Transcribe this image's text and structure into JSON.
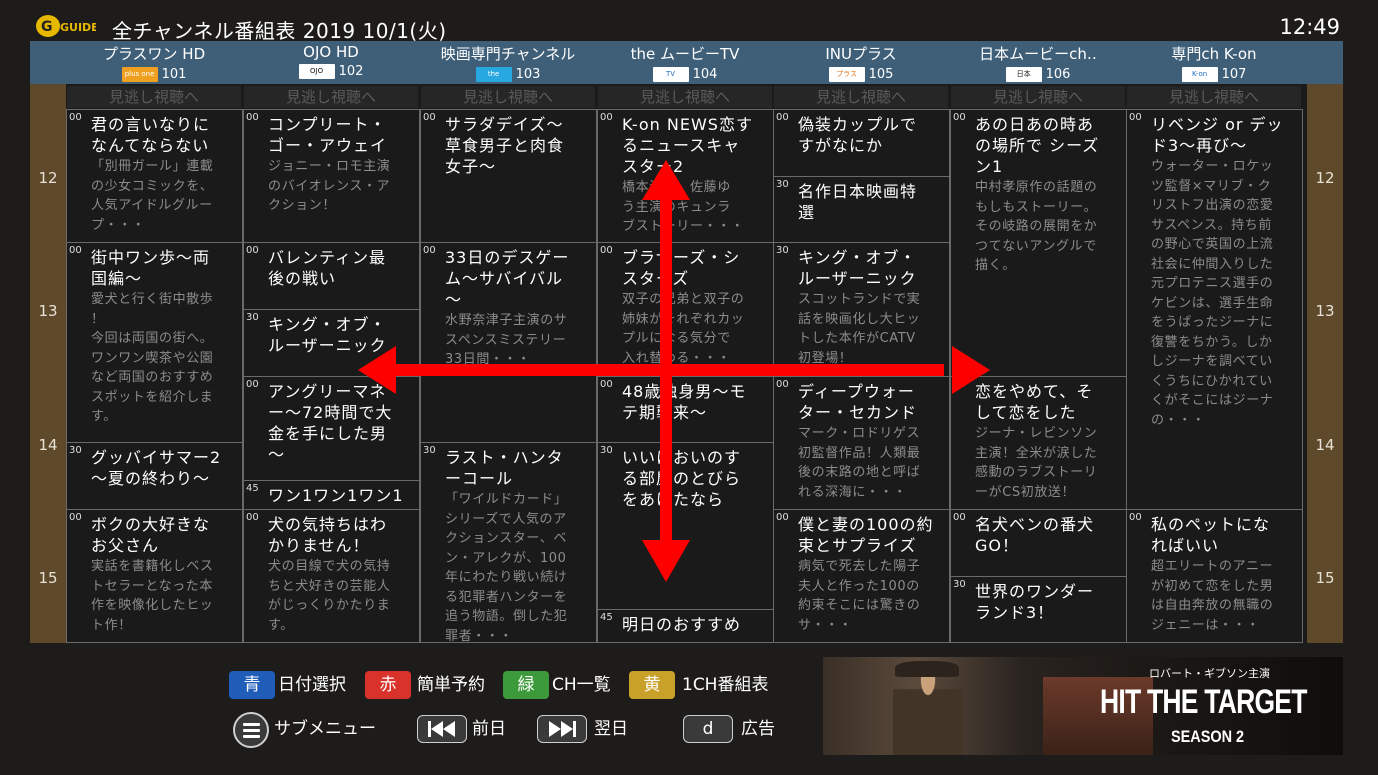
{
  "header": {
    "logo": "GUIDE",
    "title": "全チャンネル番組表 2019 10/1(火)",
    "clock": "12:49"
  },
  "channels": [
    {
      "name": "プラスワン HD",
      "logo": "plus one",
      "number": "101",
      "logo_bg": "#f0a020",
      "logo_fg": "#ffffff"
    },
    {
      "name": "OJO HD",
      "logo": "OJO",
      "number": "102",
      "logo_bg": "#ffffff",
      "logo_fg": "#111111"
    },
    {
      "name": "映画専門チャンネル",
      "logo": "the MOVIE",
      "number": "103",
      "logo_bg": "#27a8e0",
      "logo_fg": "#ffffff"
    },
    {
      "name": "the ムービーTV",
      "logo": "TV",
      "number": "104",
      "logo_bg": "#ffffff",
      "logo_fg": "#1b6fc4"
    },
    {
      "name": "INUプラス",
      "logo": "プラス",
      "number": "105",
      "logo_bg": "#ffffff",
      "logo_fg": "#e07010"
    },
    {
      "name": "日本ムービーch‥",
      "logo": "日本",
      "number": "106",
      "logo_bg": "#ffffff",
      "logo_fg": "#111111"
    },
    {
      "name": "専門ch K-on",
      "logo": "K-on",
      "number": "107",
      "logo_bg": "#ffffff",
      "logo_fg": "#1b6fc4"
    }
  ],
  "missed_label": "見逃し視聴へ",
  "hours": [
    "12",
    "13",
    "14",
    "15"
  ],
  "programs": [
    [
      {
        "min": "00",
        "title": "君の言いなりに\nなんてならない",
        "desc": "「別冊ガール」連載\nの少女コミックを、\n人気アイドルグルー\nプ・・・"
      },
      {
        "min": "00",
        "title": "街中ワン歩～両\n国編～",
        "desc": "愛犬と行く街中散歩\n！\n今回は両国の街へ。\nワンワン喫茶や公園\nなど両国のおすすめ\nスポットを紹介しま\nす。"
      },
      {
        "min": "30",
        "title": "グッバイサマー2\n～夏の終わり～",
        "desc": ""
      },
      {
        "min": "00",
        "title": "ボクの大好きな\nお父さん",
        "desc": "実話を書籍化しベス\nトセラーとなった本\n作を映像化したヒッ\nト作！"
      }
    ],
    [
      {
        "min": "00",
        "title": "コンプリート・\nゴー・アウェイ",
        "desc": "ジョニー・ロモ主演\nのバイオレンス・ア\nクション！"
      },
      {
        "min": "00",
        "title": "バレンティン最\n後の戦い",
        "desc": ""
      },
      {
        "min": "30",
        "title": "キング・オブ・\nルーザーニック",
        "desc": ""
      },
      {
        "min": "00",
        "title": "アングリーマネ\nー～72時間で大\n金を手にした男\n～",
        "desc": ""
      },
      {
        "min": "45",
        "title": "ワン1ワン1ワン1",
        "desc": ""
      },
      {
        "min": "00",
        "title": "犬の気持ちはわ\nかりません！",
        "desc": "犬の目線で犬の気持\nちと犬好きの芸能人\nがじっくりかたりま\nす。"
      }
    ],
    [
      {
        "min": "00",
        "title": "サラダデイズ～\n草食男子と肉食\n女子～",
        "desc": ""
      },
      {
        "min": "00",
        "title": "33日のデスゲー\nム～サバイバル\n～",
        "desc": "水野奈津子主演のサ\nスペンスミステリー\n33日間・・・"
      },
      {
        "min": "30",
        "title": "ラスト・ハンタ\nーコール",
        "desc": "「ワイルドカード」\nシリーズで人気のア\nクションスター、ベ\nン・アレクが、100\n年にわたり戦い続け\nる犯罪者ハンターを\n追う物語。倒した犯\n罪者・・・"
      }
    ],
    [
      {
        "min": "00",
        "title": "K-on NEWS恋す\nるニュースキャ\nスター2",
        "desc": "橋本海斗、佐藤ゆ\nう主演のキュンラ\nブストーリー・・・"
      },
      {
        "min": "00",
        "title": "ブラザーズ・シ\nスターズ",
        "desc": "双子の兄弟と双子の\n姉妹がそれぞれカッ\nプルになる気分で\n入れ替わる・・・"
      },
      {
        "min": "00",
        "title": "48歳独身男～モ\nテ期襲来～",
        "desc": ""
      },
      {
        "min": "30",
        "title": "いいにおいのす\nる部屋のとびら\nをあけたなら",
        "desc": ""
      },
      {
        "min": "45",
        "title": "明日のおすすめ",
        "desc": ""
      }
    ],
    [
      {
        "min": "00",
        "title": "偽装カップルで\nすがなにか",
        "desc": ""
      },
      {
        "min": "30",
        "title": "名作日本映画特\n選",
        "desc": ""
      },
      {
        "min": "30",
        "title": "キング・オブ・\nルーザーニック",
        "desc": "スコットランドで実\n話を映画化し大ヒッ\nトした本作がCATV\n初登場！"
      },
      {
        "min": "00",
        "title": "ディープウォー\nター・セカンド",
        "desc": "マーク・ロドリゲス\n初監督作品！人類最\n後の末路の地と呼ば\nれる深海に・・・"
      },
      {
        "min": "00",
        "title": "僕と妻の100の約\n束とサプライズ",
        "desc": "病気で死去した陽子\n夫人と作った100の\n約束そこには驚きの\nサ・・・"
      }
    ],
    [
      {
        "min": "00",
        "title": "あの日あの時あ\nの場所で シーズ\nン1",
        "desc": "中村孝原作の話題の\nもしもストーリー。\nその岐路の展開をか\nつてないアングルで\n描く。"
      },
      {
        "min": "00",
        "title": "恋をやめて、そ\nして恋をした",
        "desc": "ジーナ・レビンソン\n主演！全米が涙した\n感動のラブストーリ\nーがCS初放送！"
      },
      {
        "min": "00",
        "title": "名犬ベンの番犬\nGO！",
        "desc": ""
      },
      {
        "min": "30",
        "title": "世界のワンダー\nランド3！",
        "desc": ""
      }
    ],
    [
      {
        "min": "00",
        "title": "リベンジ or デッ\nド3～再び～",
        "desc": "ウォーター・ロケッ\nツ監督×マリブ・ク\nリストフ出演の恋愛\nサスペンス。持ち前\nの野心で英国の上流\n社会に仲間入りした\n元プロテニス選手の\nケビンは、選手生命\nをうばったジーナに\n復讐をちかう。しか\nしジーナを調べてい\nくうちにひかれてい\nくがそこにはジーナ\nの・・・"
      },
      {
        "min": "00",
        "title": "私のペットにな\nればいい",
        "desc": "超エリートのアニー\nが初めて恋をした男\nは自由奔放の無職の\nジェニーは・・・"
      }
    ]
  ],
  "footer": {
    "blue_key": "青",
    "blue_label": "日付選択",
    "red_key": "赤",
    "red_label": "簡単予約",
    "green_key": "緑",
    "green_label": "CH一覧",
    "yellow_key": "黄",
    "yellow_label": "1CH番組表",
    "submenu_label": "サブメニュー",
    "prev_label": "前日",
    "next_label": "翌日",
    "d_key": "d",
    "ad_label": "広告"
  },
  "ad": {
    "subtitle": "ロバート・ギブソン主演",
    "title": "HIT THE TARGET",
    "season": "SEASON 2"
  },
  "colors": {
    "blue": "#1f5db8",
    "red": "#d8322a",
    "green": "#3d9a3a",
    "yellow": "#c9a028",
    "arrow": "#ff0000",
    "header": "#3f5f79"
  }
}
